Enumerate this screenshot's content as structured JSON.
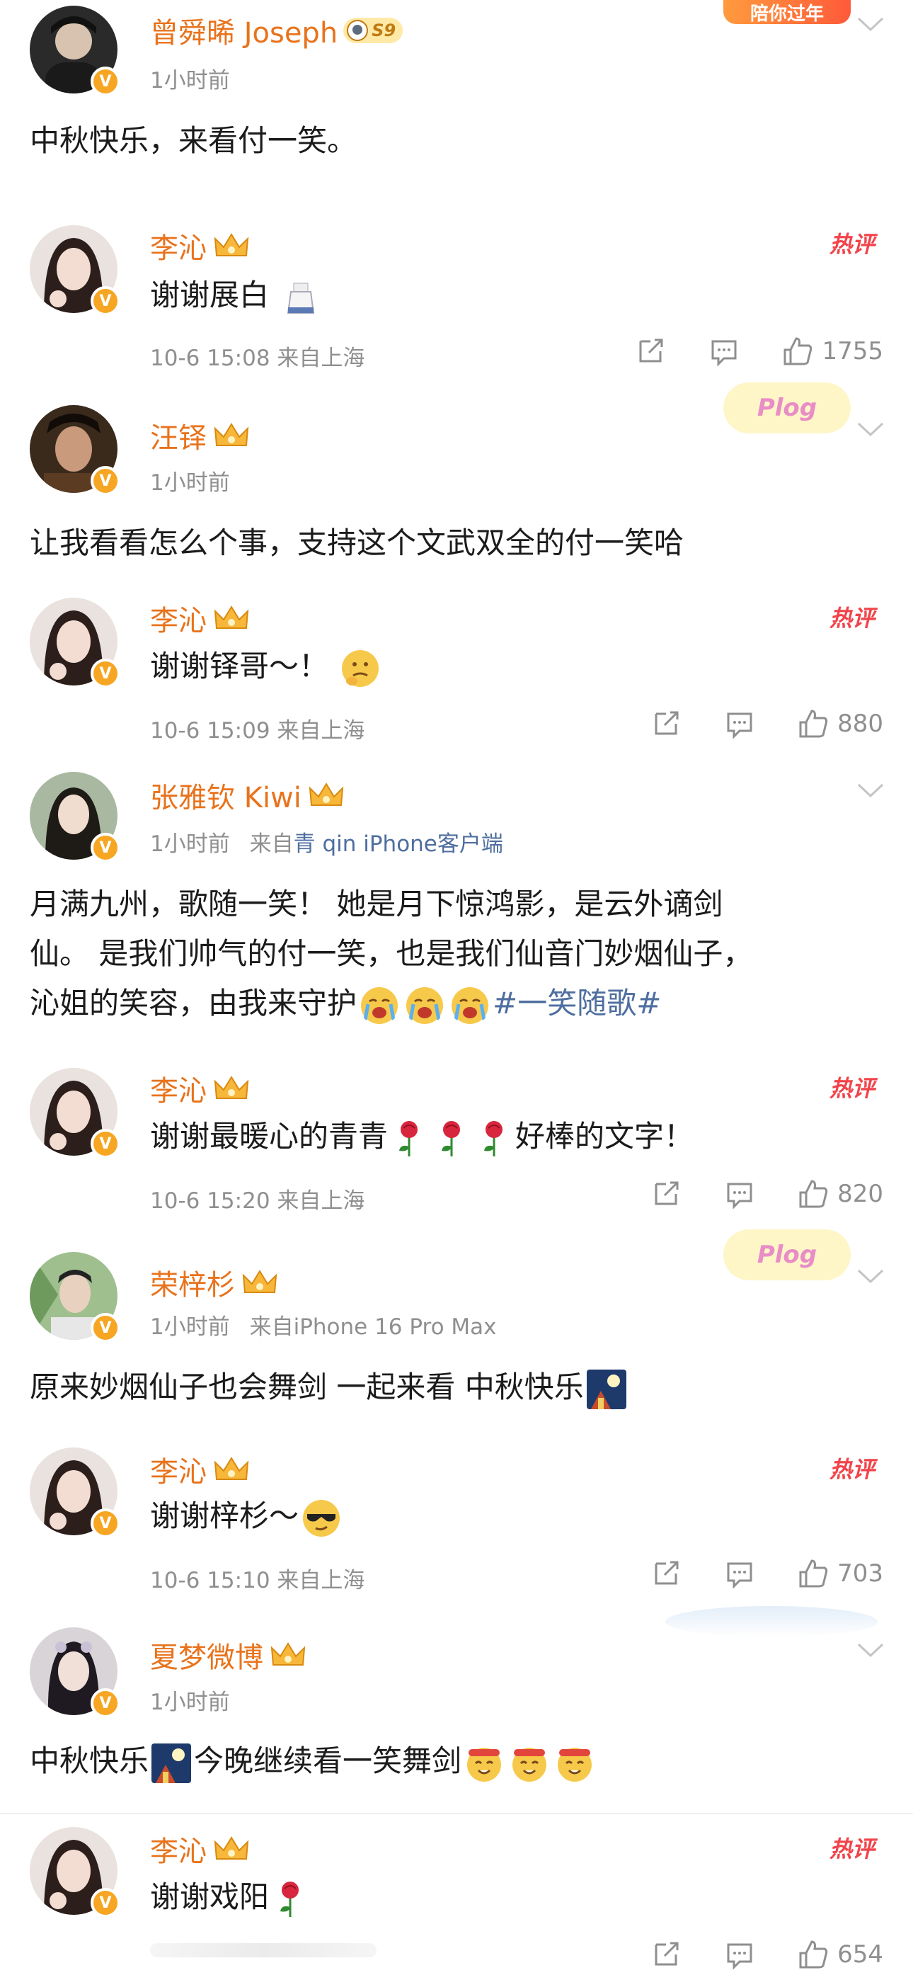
{
  "comments": [
    {
      "user": "曾舜晞 Joseph",
      "level": "S9",
      "time": "1小时前",
      "text": "中秋快乐，来看付一笑。",
      "reply": {
        "user": "李沁",
        "text": "谢谢展白",
        "time": "10-6 15:08 来自上海",
        "likes": "1755",
        "hot": "热评"
      }
    },
    {
      "user": "汪铎",
      "time": "1小时前",
      "text": "让我看看怎么个事，支持这个文武双全的付一笑哈",
      "deco": "Plog",
      "reply": {
        "user": "李沁",
        "text": "谢谢铎哥～！",
        "time": "10-6 15:09 来自上海",
        "likes": "880",
        "hot": "热评"
      }
    },
    {
      "user": "张雅钦 Kiwi",
      "time": "1小时前",
      "source_prefix": "来自",
      "source_link": "青 qin iPhone客户端",
      "text_lines": [
        "月满九州，歌随一笑！ 她是月下惊鸿影，是云外谪剑",
        "仙。 是我们帅气的付一笑，也是我们仙音门妙烟仙子，",
        "沁姐的笑容，由我来守护"
      ],
      "hashtag": "#一笑随歌#",
      "reply": {
        "user": "李沁",
        "text_a": "谢谢最暖心的青青",
        "text_b": "好棒的文字！",
        "time": "10-6 15:20 来自上海",
        "likes": "820",
        "hot": "热评"
      }
    },
    {
      "user": "荣梓杉",
      "time": "1小时前",
      "source": "来自iPhone 16 Pro Max",
      "text": "原来妙烟仙子也会舞剑 一起来看 中秋快乐",
      "deco": "Plog",
      "reply": {
        "user": "李沁",
        "text": "谢谢梓杉～",
        "time": "10-6 15:10 来自上海",
        "likes": "703",
        "hot": "热评"
      }
    },
    {
      "user": "夏梦微博",
      "time": "1小时前",
      "text_a": "中秋快乐",
      "text_b": "今晚继续看一笑舞剑",
      "reply": {
        "user": "李沁",
        "text": "谢谢戏阳",
        "likes": "654",
        "hot": "热评"
      }
    }
  ],
  "top_banner": "陪你过年",
  "colors": {
    "name": "#e8731c",
    "meta": "#8f8f8f",
    "link": "#4e6e9f",
    "hot": "#f2434a",
    "verified": "#f6a623"
  }
}
